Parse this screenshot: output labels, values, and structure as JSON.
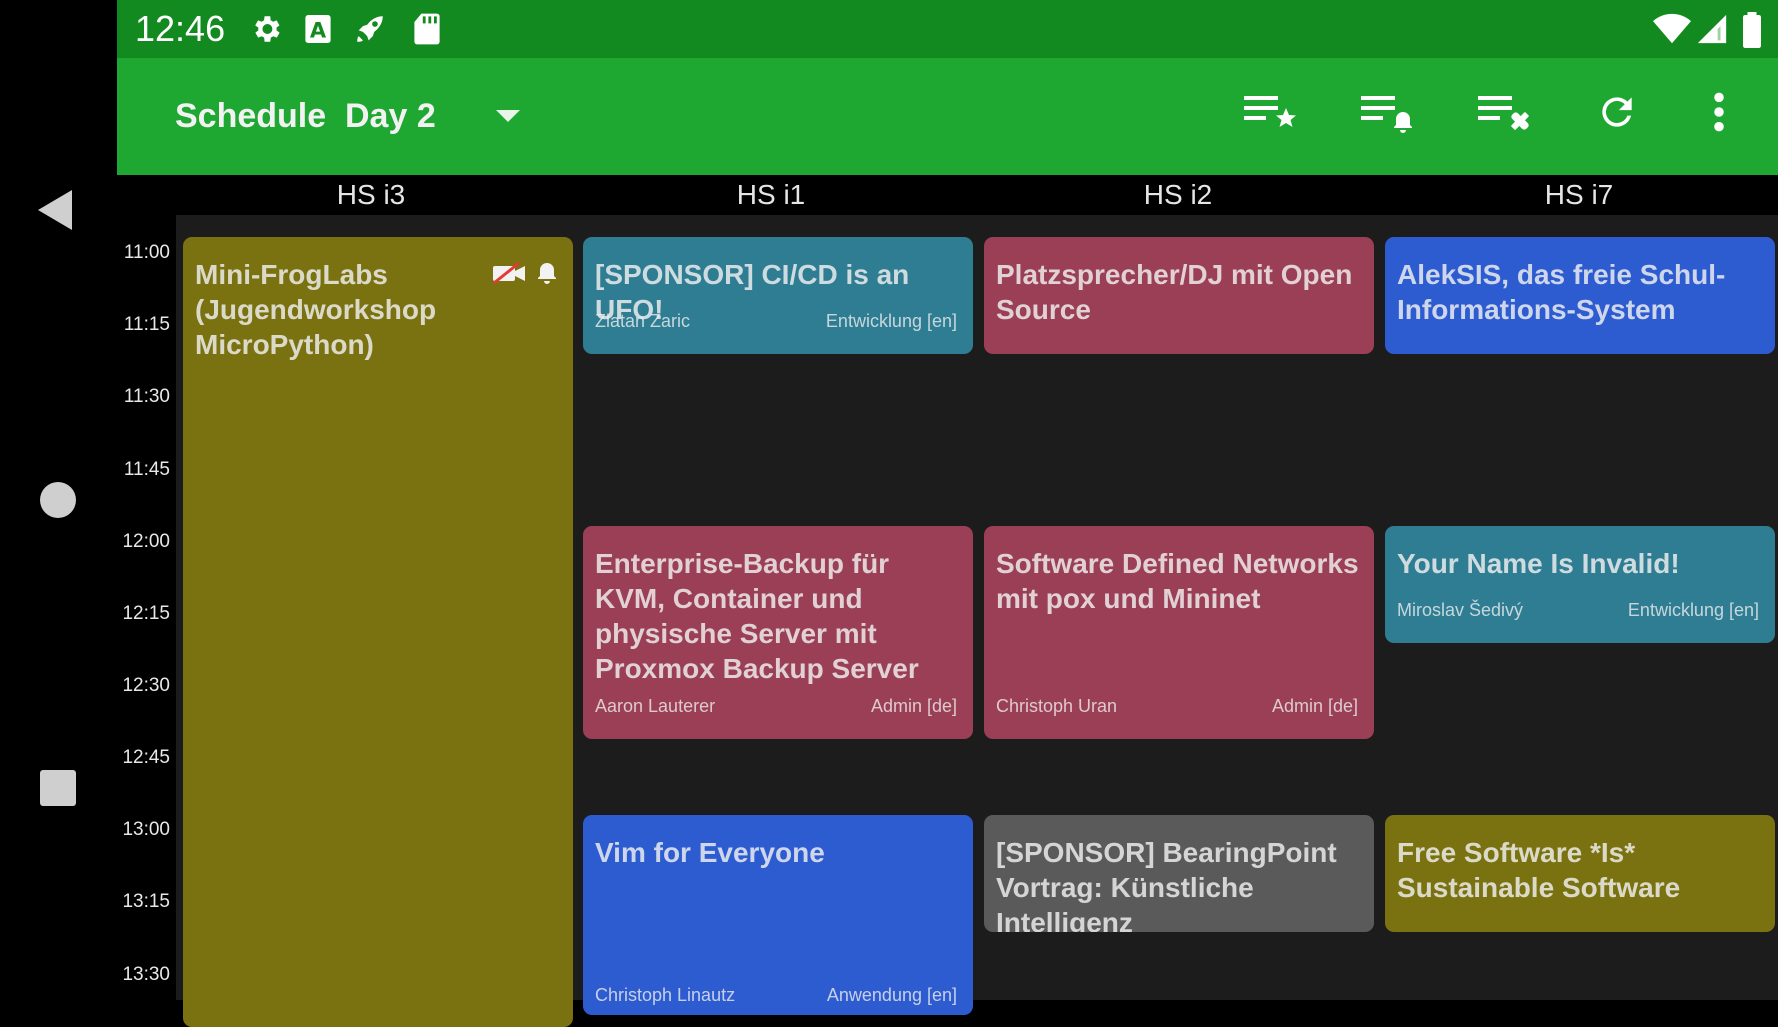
{
  "status_bar": {
    "time": "12:46",
    "icons": [
      "settings-gear-icon",
      "a-badge-icon",
      "rocket-icon",
      "sd-card-icon",
      "wifi-icon",
      "cell-signal-icon",
      "battery-icon"
    ]
  },
  "app_bar": {
    "title": "Schedule",
    "day": "Day 2",
    "actions": [
      "favorites-list-icon",
      "alarms-list-icon",
      "clear-list-icon",
      "refresh-icon",
      "overflow-menu-icon"
    ],
    "color": "#1ea832"
  },
  "rooms": [
    "HS i3",
    "HS i1",
    "HS i2",
    "HS i7"
  ],
  "times": [
    "11:00",
    "11:15",
    "11:30",
    "11:45",
    "12:00",
    "12:15",
    "12:30",
    "12:45",
    "13:00",
    "13:15",
    "13:30"
  ],
  "events": {
    "frog": {
      "title": "Mini-FrogLabs (Jugendworkshop MicroPython)",
      "color": "#7a7210"
    },
    "ufo": {
      "title": "[SPONSOR] CI/CD is an UFO!",
      "speaker": "Zlatan Zaric",
      "track": "Entwicklung [en]",
      "color": "#2f7d93"
    },
    "dj": {
      "title": "Platzsprecher/DJ mit Open Source",
      "color": "#9a3f55"
    },
    "aleksis": {
      "title": "AlekSIS, das freie Schul-Informations-System",
      "color": "#2d5bd0"
    },
    "backup": {
      "title": "Enterprise-Backup für KVM, Container und physische Server mit Proxmox Backup Server",
      "speaker": "Aaron Lauterer",
      "track": "Admin [de]",
      "color": "#9a3f55"
    },
    "sdn": {
      "title": "Software Defined Networks mit pox und Mininet",
      "speaker": "Christoph Uran",
      "track": "Admin [de]",
      "color": "#9a3f55"
    },
    "invalid": {
      "title": "Your Name Is Invalid!",
      "speaker": "Miroslav Šedivý",
      "track": "Entwicklung [en]",
      "color": "#2f7d93"
    },
    "vim": {
      "title": "Vim for Everyone",
      "speaker": "Christoph Linautz",
      "track": "Anwendung [en]",
      "color": "#2d5bd0"
    },
    "bearing": {
      "title": "[SPONSOR] BearingPoint Vortrag: Künstliche Intelligenz",
      "color": "#5a5a5a"
    },
    "sustainable": {
      "title": "Free Software *Is* Sustainable Software",
      "color": "#7a7210"
    }
  }
}
